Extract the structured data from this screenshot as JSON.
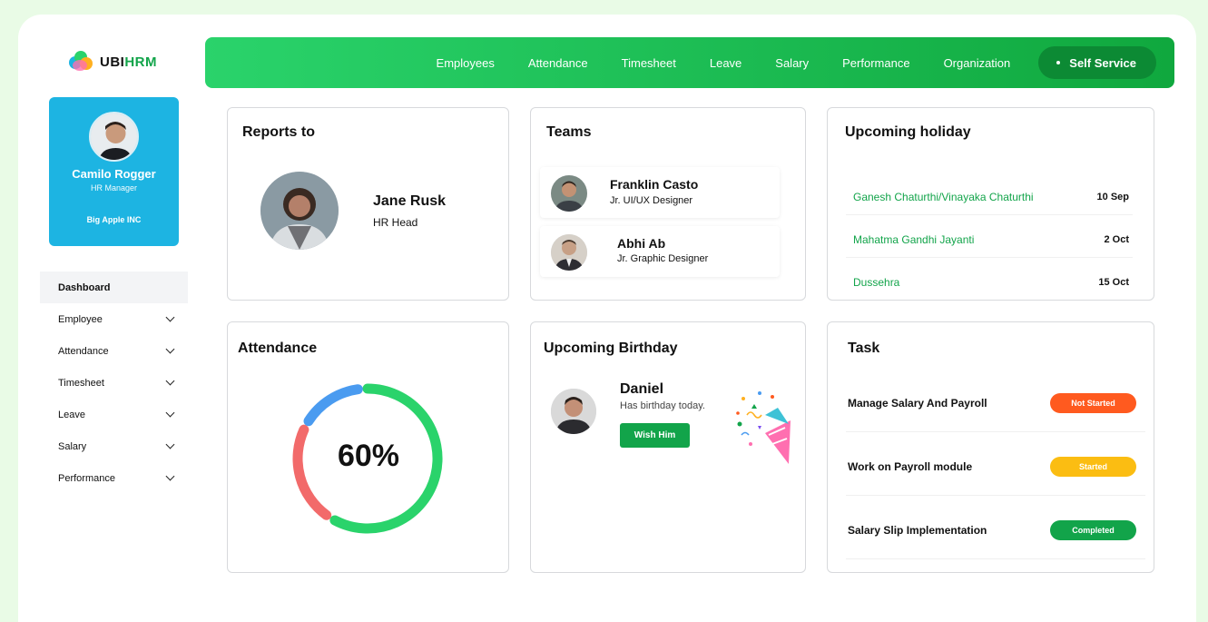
{
  "brand": {
    "prefix": "UBI",
    "suffix": "HRM"
  },
  "user": {
    "name": "Camilo Rogger",
    "role": "HR Manager",
    "company": "Big Apple INC"
  },
  "sidebar": {
    "items": [
      {
        "label": "Dashboard"
      },
      {
        "label": "Employee"
      },
      {
        "label": "Attendance"
      },
      {
        "label": "Timesheet"
      },
      {
        "label": "Leave"
      },
      {
        "label": "Salary"
      },
      {
        "label": "Performance"
      }
    ]
  },
  "topnav": {
    "items": [
      "Employees",
      "Attendance",
      "Timesheet",
      "Leave",
      "Salary",
      "Performance",
      "Organization"
    ],
    "self_service": "Self Service"
  },
  "reports_to": {
    "title": "Reports to",
    "name": "Jane Rusk",
    "role": "HR Head"
  },
  "teams": {
    "title": "Teams",
    "members": [
      {
        "name": "Franklin Casto",
        "role": "Jr. UI/UX Designer"
      },
      {
        "name": "Abhi Ab",
        "role": "Jr. Graphic Designer"
      }
    ]
  },
  "holidays": {
    "title": "Upcoming holiday",
    "items": [
      {
        "name": "Ganesh Chaturthi/Vinayaka Chaturthi",
        "date": "10 Sep"
      },
      {
        "name": "Mahatma Gandhi Jayanti",
        "date": "2 Oct"
      },
      {
        "name": "Dussehra",
        "date": "15 Oct"
      }
    ]
  },
  "attendance": {
    "title": "Attendance",
    "percent_label": "60%",
    "value": 0.6
  },
  "birthday": {
    "title": "Upcoming Birthday",
    "name": "Daniel",
    "subtitle": "Has birthday today.",
    "button": "Wish Him"
  },
  "tasks": {
    "title": "Task",
    "items": [
      {
        "name": "Manage Salary And Payroll",
        "status": "Not Started",
        "color": "#ff5a1f"
      },
      {
        "name": "Work on Payroll module",
        "status": "Started",
        "color": "#fbbd12"
      },
      {
        "name": "Salary Slip Implementation",
        "status": "Completed",
        "color": "#12a44a"
      }
    ]
  },
  "colors": {
    "accent": "#12a44a",
    "profile_bg": "#1db4e2",
    "ring_green": "#2ad36b",
    "ring_red": "#f26a6a",
    "ring_blue": "#4a9bf0"
  }
}
